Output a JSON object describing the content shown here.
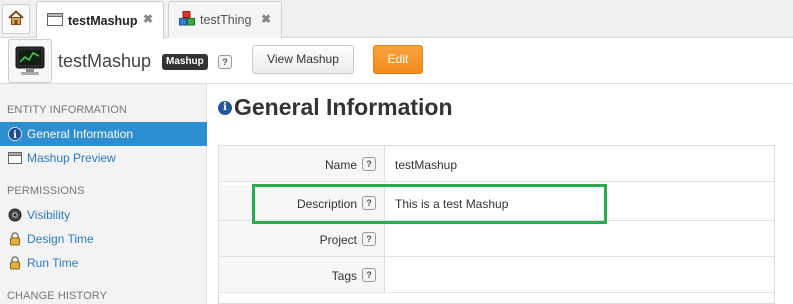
{
  "tabs": [
    {
      "label": "testMashup",
      "icon": "mashup-window-icon",
      "active": true
    },
    {
      "label": "testThing",
      "icon": "thing-blocks-icon",
      "active": false
    }
  ],
  "header": {
    "entity_name": "testMashup",
    "type_badge": "Mashup",
    "help": "?",
    "view_button": "View Mashup",
    "edit_button": "Edit"
  },
  "sidebar": {
    "sections": [
      {
        "title": "ENTITY INFORMATION"
      },
      {
        "title": "PERMISSIONS"
      },
      {
        "title": "CHANGE HISTORY"
      }
    ],
    "items": [
      {
        "label": "General Information",
        "icon": "info-icon",
        "active": true
      },
      {
        "label": "Mashup Preview",
        "icon": "preview-window-icon",
        "active": false
      },
      {
        "label": "Visibility",
        "icon": "visibility-icon",
        "active": false
      },
      {
        "label": "Design Time",
        "icon": "lock-icon",
        "active": false
      },
      {
        "label": "Run Time",
        "icon": "lock-icon",
        "active": false
      }
    ]
  },
  "main": {
    "title": "General Information",
    "fields": [
      {
        "label": "Name",
        "value": "testMashup"
      },
      {
        "label": "Description",
        "value": "This is a test Mashup"
      },
      {
        "label": "Project",
        "value": ""
      },
      {
        "label": "Tags",
        "value": ""
      }
    ]
  },
  "colors": {
    "accent": "#2d8ed0",
    "edit_button": "#f28c1c",
    "highlight": "#2bab4e",
    "link": "#2a7bbf"
  }
}
